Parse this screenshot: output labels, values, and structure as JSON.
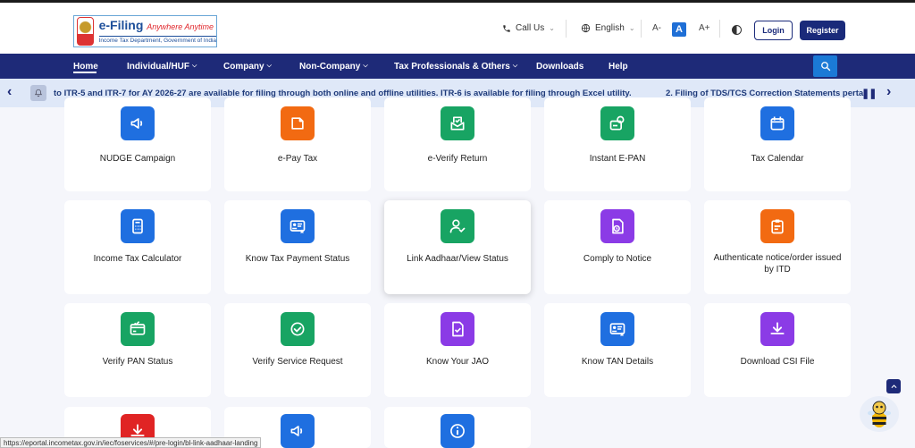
{
  "header": {
    "logo_title": "e-Filing",
    "logo_tagline": "Anywhere Anytime",
    "logo_sub": "Income Tax Department, Government of India",
    "call_us": "Call Us",
    "language": "English",
    "font_decrease": "A-",
    "font_default": "A",
    "font_increase": "A+",
    "login": "Login",
    "register": "Register"
  },
  "nav": {
    "items": [
      "Home",
      "Individual/HUF",
      "Company",
      "Non-Company",
      "Tax Professionals & Others",
      "Downloads",
      "Help"
    ]
  },
  "ticker": {
    "text1": "to ITR-5 and ITR-7 for AY 2026-27 are available for filing through both online and offline utilities. ITR-6 is available for filing through Excel utility.",
    "text2": "2. Filing of TDS/TCS Correction Statements perta"
  },
  "cards": [
    {
      "label": "NUDGE Campaign",
      "color": "#1f6fe0",
      "icon": "megaphone-icon"
    },
    {
      "label": "e-Pay Tax",
      "color": "#f26a12",
      "icon": "wallet-icon"
    },
    {
      "label": "e-Verify Return",
      "color": "#18a463",
      "icon": "envelope-check-icon"
    },
    {
      "label": "Instant E-PAN",
      "color": "#18a463",
      "icon": "pan-card-globe-icon"
    },
    {
      "label": "Tax Calendar",
      "color": "#1f6fe0",
      "icon": "calendar-icon"
    },
    {
      "label": "Income Tax Calculator",
      "color": "#1f6fe0",
      "icon": "calculator-icon"
    },
    {
      "label": "Know Tax Payment Status",
      "color": "#1f6fe0",
      "icon": "id-card-star-icon"
    },
    {
      "label": "Link Aadhaar/View Status",
      "color": "#18a463",
      "icon": "user-check-icon"
    },
    {
      "label": "Comply to Notice",
      "color": "#8b3be6",
      "icon": "document-clock-icon"
    },
    {
      "label": "Authenticate notice/order issued by ITD",
      "color": "#f26a12",
      "icon": "clipboard-icon"
    },
    {
      "label": "Verify PAN Status",
      "color": "#18a463",
      "icon": "card-check-icon"
    },
    {
      "label": "Verify Service Request",
      "color": "#18a463",
      "icon": "badge-check-icon"
    },
    {
      "label": "Know Your JAO",
      "color": "#8b3be6",
      "icon": "document-check-icon"
    },
    {
      "label": "Know TAN Details",
      "color": "#1f6fe0",
      "icon": "id-card-star-icon"
    },
    {
      "label": "Download CSI File",
      "color": "#8b3be6",
      "icon": "download-icon"
    },
    {
      "label": "",
      "color": "#e02424",
      "icon": "download-icon"
    },
    {
      "label": "",
      "color": "#1f6fe0",
      "icon": "megaphone-icon"
    },
    {
      "label": "",
      "color": "#1f6fe0",
      "icon": "info-icon"
    }
  ],
  "status_url": "https://eportal.incometax.gov.in/iec/foservices/#/pre-login/bl-link-aadhaar-landing"
}
